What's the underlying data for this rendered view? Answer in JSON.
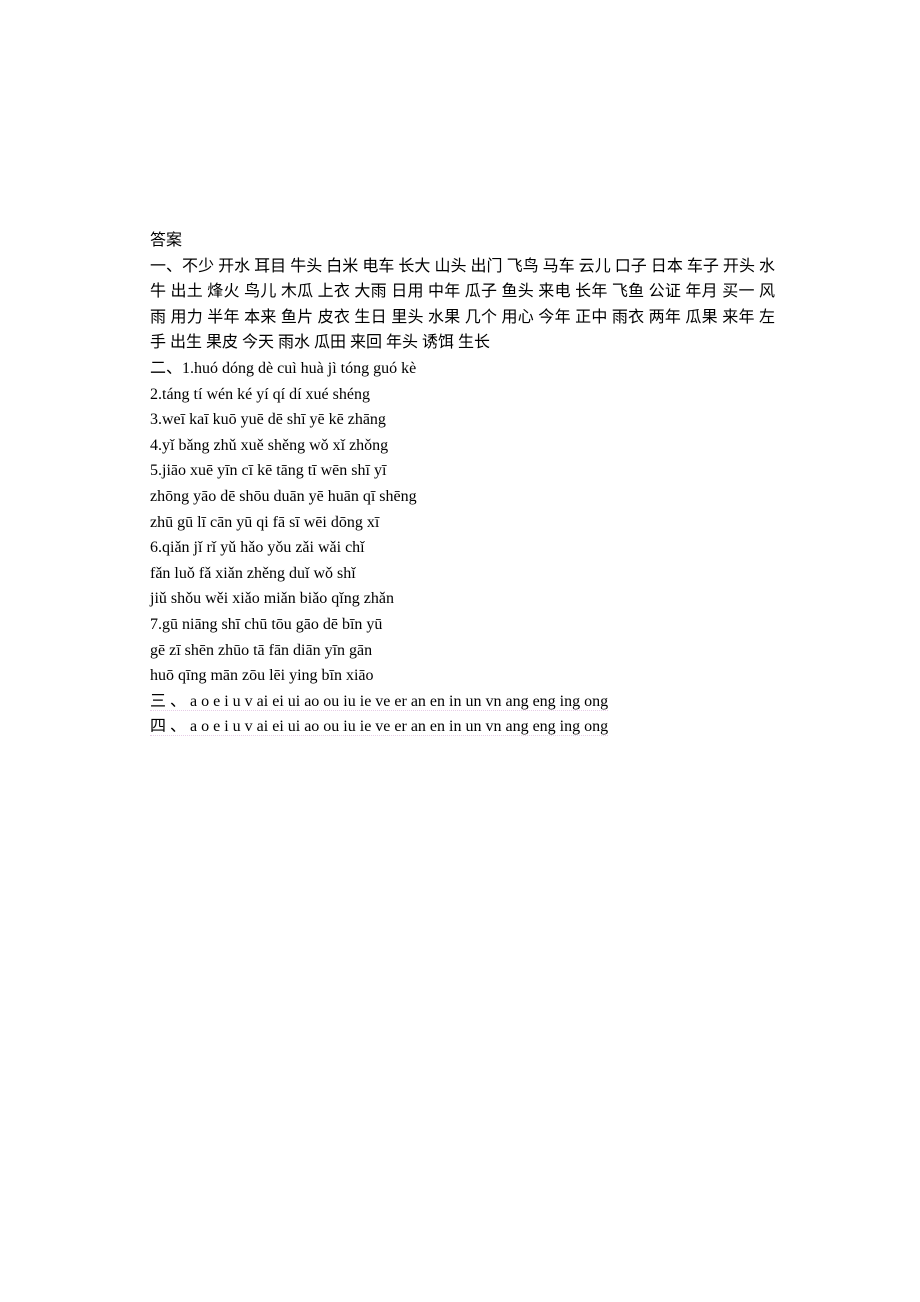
{
  "title": "答案",
  "section1": {
    "heading": "一、",
    "words": "不少 开水 耳目 牛头 白米 电车 长大 山头 出门 飞鸟 马车 云儿 口子 日本 车子 开头 水牛 出土 烽火 鸟儿 木瓜 上衣 大雨 日用 中年 瓜子 鱼头 来电 长年 飞鱼 公证 年月 买一 风雨 用力 半年 本来 鱼片 皮衣 生日 里头 水果 几个 用心 今年 正中 雨衣 两年 瓜果 来年 左手 出生 果皮 今天 雨水 瓜田 来回 年头 诱饵 生长"
  },
  "section2": {
    "heading": "二、",
    "items": [
      {
        "num": "1.",
        "text": "huó dóng dè cuì huà jì tóng guó kè"
      },
      {
        "num": "2.",
        "text": "táng tí wén   ké yí qí dí xué shéng"
      },
      {
        "num": "3.",
        "text": "weī kaī kuō yuē dē shī yē kē zhāng"
      },
      {
        "num": "4.",
        "text": "yǐ bǎng zhǔ xuě shěng   wǒ xǐ zhǒng"
      },
      {
        "num": "5.",
        "text": "jiāo xuē   yīn cī   kē tāng tī wēn shī yī"
      },
      {
        "num": "",
        "text": "zhōng yāo dē shōu duān yē huān qī shēng"
      },
      {
        "num": "",
        "text": "zhū   gū lī cān yū   qi fā sī wēi dōng xī"
      },
      {
        "num": "6.",
        "text": "qiǎn jǐ rǐ   yǔ hǎo yǒu zǎi wǎi chǐ"
      },
      {
        "num": "",
        "text": "fǎn luǒ fǎ xiǎn zhěng duǐ wǒ shǐ"
      },
      {
        "num": "",
        "text": "jiǔ shǒu wěi xiǎo miǎn biǎo qǐng zhǎn"
      },
      {
        "num": "7.",
        "text": "gū niāng   shī chū tōu   gāo dē bīn yū"
      },
      {
        "num": "",
        "text": "gē zī shēn zhūo   tā fān diān yīn gān"
      },
      {
        "num": "",
        "text": "huō   qīng mān zōu   lēi ying bīn xiāo"
      }
    ]
  },
  "section3": {
    "heading": "三 、",
    "text": " a  o  e  i  u  v  ai  ei  ui  ao  ou  iu  ie  ve  er  an  en  in  un  vn  ang  eng  ing  ong"
  },
  "section4": {
    "heading": "四 、",
    "text": " a  o  e  i  u  v  ai  ei  ui  ao  ou  iu  ie  ve  er  an  en  in  un  vn  ang  eng  ing  ong"
  }
}
